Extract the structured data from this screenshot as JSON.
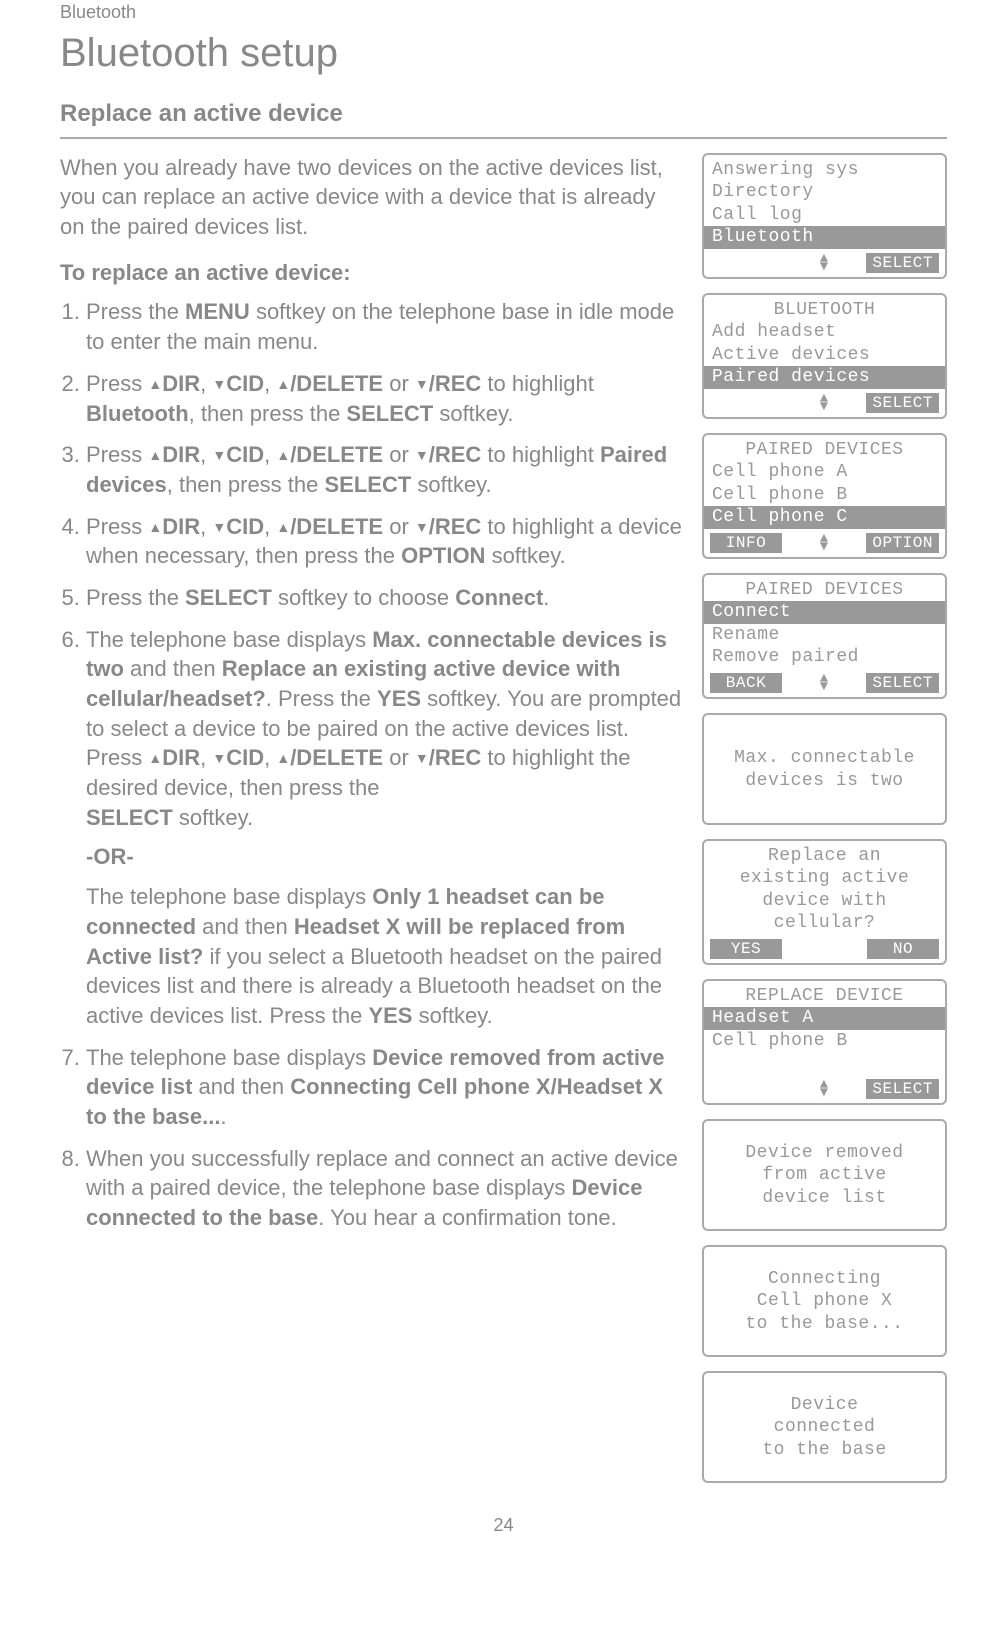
{
  "breadcrumb": "Bluetooth",
  "title": "Bluetooth setup",
  "heading": "Replace an active device",
  "intro": "When you already have two devices on the active devices list, you can replace an active device with a device that is already on the paired devices list.",
  "subhead": "To replace an active device:",
  "buttons": {
    "dir": "DIR",
    "cid": "CID",
    "delete": "/DELETE",
    "rec": "/REC"
  },
  "step1_a": "Press the ",
  "step1_key": "MENU",
  "step1_b": " softkey on the telephone base in idle mode to enter the main menu.",
  "step2_a": "Press ",
  "step2_mid": " to highlight ",
  "step2_item": "Bluetooth",
  "step2_b": ", then press the ",
  "step2_key": "SELECT",
  "step2_c": " softkey.",
  "step3_item": "Paired devices",
  "step4_mid": " to highlight a device when necessary, then press the ",
  "step4_key": "OPTION",
  "step4_end": " softkey.",
  "step5_a": "Press the ",
  "step5_key": "SELECT",
  "step5_b": " softkey to choose ",
  "step5_item": "Connect",
  "step5_c": ".",
  "step6_a": "The telephone base displays ",
  "step6_m1": "Max. connectable devices is two",
  "step6_b": " and then ",
  "step6_m2": "Replace an existing active device with cellular/headset?",
  "step6_c": ". Press the ",
  "step6_yes": "YES",
  "step6_d": " softkey. You are prompted to select a device to be paired on the active devices list. Press ",
  "step6_e": " to highlight the desired device, then press the ",
  "step6_sel": "SELECT",
  "step6_f": " softkey.",
  "or_label": "-OR-",
  "step6b_a": "The telephone base displays ",
  "step6b_m1": "Only 1 headset can be connected",
  "step6b_b": " and then ",
  "step6b_m2": "Headset X will be replaced from Active list?",
  "step6b_c": " if you select a Bluetooth headset on the paired devices list and there is already a Bluetooth headset on the active devices list. Press the ",
  "step6b_yes": "YES",
  "step6b_d": " softkey.",
  "step7_a": "The telephone base displays ",
  "step7_m1": "Device removed from active device list",
  "step7_b": " and then ",
  "step7_m2": "Connecting Cell phone X/Headset X to the base...",
  "step7_c": ".",
  "step8_a": "When you successfully replace and connect an active device with a paired device, the telephone base displays ",
  "step8_m1": "Device connected to the base",
  "step8_b": ". You hear a confirmation tone.",
  "page_number": "24",
  "softkeys": {
    "select": "SELECT",
    "info": "INFO",
    "option": "OPTION",
    "back": "BACK",
    "yes": "YES",
    "no": "NO"
  },
  "lcd1": {
    "r1": "Answering sys",
    "r2": "Directory",
    "r3": "Call log",
    "r4": "Bluetooth"
  },
  "lcd2": {
    "title": "BLUETOOTH",
    "r1": "Add headset",
    "r2": "Active devices",
    "r3": "Paired devices"
  },
  "lcd3": {
    "title": "PAIRED DEVICES",
    "r1": "Cell phone A",
    "r2": "Cell phone B",
    "r3": "Cell phone C"
  },
  "lcd4": {
    "title": "PAIRED DEVICES",
    "r1": "Connect",
    "r2": "Rename",
    "r3": "Remove paired"
  },
  "lcd5": {
    "l1": "Max. connectable",
    "l2": "devices is two"
  },
  "lcd6": {
    "l1": "Replace an",
    "l2": "existing active",
    "l3": "device with",
    "l4": "cellular?"
  },
  "lcd7": {
    "title": "REPLACE DEVICE",
    "r1": "Headset A",
    "r2": "Cell phone B"
  },
  "lcd8": {
    "l1": "Device removed",
    "l2": "from active",
    "l3": "device list"
  },
  "lcd9": {
    "l1": "Connecting",
    "l2": "Cell phone X",
    "l3": "to the base..."
  },
  "lcd10": {
    "l1": "Device",
    "l2": "connected",
    "l3": "to the base"
  }
}
